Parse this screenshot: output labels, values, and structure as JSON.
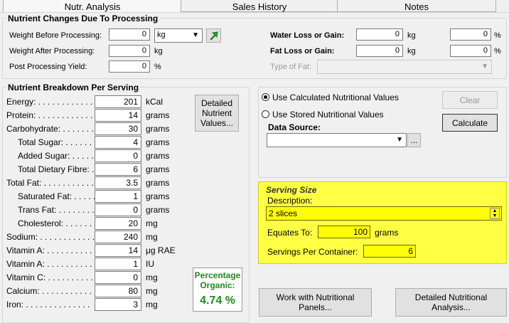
{
  "tabs": [
    {
      "label": "Nutr. Analysis",
      "active": true
    },
    {
      "label": "Sales History",
      "active": false
    },
    {
      "label": "Notes",
      "active": false
    }
  ],
  "processing": {
    "title": "Nutrient Changes Due To Processing",
    "weight_before_label": "Weight Before Processing:",
    "weight_before_value": "0",
    "weight_unit_select": "kg",
    "weight_after_label": "Weight After Processing:",
    "weight_after_value": "0",
    "weight_after_unit": "kg",
    "yield_label": "Post Processing Yield:",
    "yield_value": "0",
    "yield_unit": "%",
    "water_loss_label": "Water Loss or Gain:",
    "water_loss_kg": "0",
    "water_loss_kg_unit": "kg",
    "water_loss_pct": "0",
    "water_loss_pct_unit": "%",
    "fat_loss_label": "Fat Loss or Gain:",
    "fat_loss_kg": "0",
    "fat_loss_kg_unit": "kg",
    "fat_loss_pct": "0",
    "fat_loss_pct_unit": "%",
    "type_of_fat_label": "Type of Fat:",
    "type_of_fat_value": ""
  },
  "breakdown": {
    "title": "Nutrient Breakdown Per Serving",
    "rows": [
      {
        "label": "Energy: . . . . . . . . . . . . .",
        "value": "201",
        "unit": "kCal"
      },
      {
        "label": "Protein: . . . . . . . . . . . .",
        "value": "14",
        "unit": "grams"
      },
      {
        "label": "Carbohydrate: . . . . . . .",
        "value": "30",
        "unit": "grams"
      },
      {
        "label": "Total Sugar: . . . . . . . .",
        "value": "4",
        "unit": "grams"
      },
      {
        "label": "Added Sugar: . . . . . .",
        "value": "0",
        "unit": "grams"
      },
      {
        "label": "Total Dietary Fibre: . .",
        "value": "6",
        "unit": "grams"
      },
      {
        "label": "Total Fat: . . . . . . . . . . .",
        "value": "3.5",
        "unit": "grams"
      },
      {
        "label": "Saturated Fat: . . . . .",
        "value": "1",
        "unit": "grams"
      },
      {
        "label": "Trans Fat: . . . . . . . .",
        "value": "0",
        "unit": "grams"
      },
      {
        "label": "Cholesterol: . . . . . . .",
        "value": "20",
        "unit": "mg"
      },
      {
        "label": "Sodium: . . . . . . . . . . . .",
        "value": "240",
        "unit": "mg"
      },
      {
        "label": "Vitamin A: . . . . . . . . . .",
        "value": "14",
        "unit": "μg RAE"
      },
      {
        "label": "Vitamin A: . . . . . . . . . .",
        "value": "1",
        "unit": "IU"
      },
      {
        "label": "Vitamin C: . . . . . . . . . .",
        "value": "0",
        "unit": "mg"
      },
      {
        "label": "Calcium: . . . . . . . . . . .",
        "value": "80",
        "unit": "mg"
      },
      {
        "label": "Iron: . . . . . . . . . . . . . .",
        "value": "3",
        "unit": "mg"
      }
    ],
    "detailed_values_button": "Detailed Nutrient Values...",
    "organic_label": "Percentage Organic:",
    "organic_value": "4.74 %"
  },
  "source": {
    "use_calculated_label": "Use Calculated Nutritional Values",
    "use_stored_label": "Use Stored Nutritional Values",
    "data_source_label": "Data Source:",
    "data_source_value": "",
    "browse_button": "...",
    "clear_button": "Clear",
    "calculate_button": "Calculate"
  },
  "serving": {
    "title": "Serving Size",
    "description_label": "Description:",
    "description_value": "2 slices",
    "equates_label": "Equates To:",
    "equates_value": "100",
    "equates_unit": "grams",
    "servings_label": "Servings Per Container:",
    "servings_value": "6",
    "accent_color": "#ffff44"
  },
  "bottom_buttons": {
    "panels": "Work with Nutritional Panels...",
    "analysis": "Detailed Nutritional Analysis..."
  }
}
